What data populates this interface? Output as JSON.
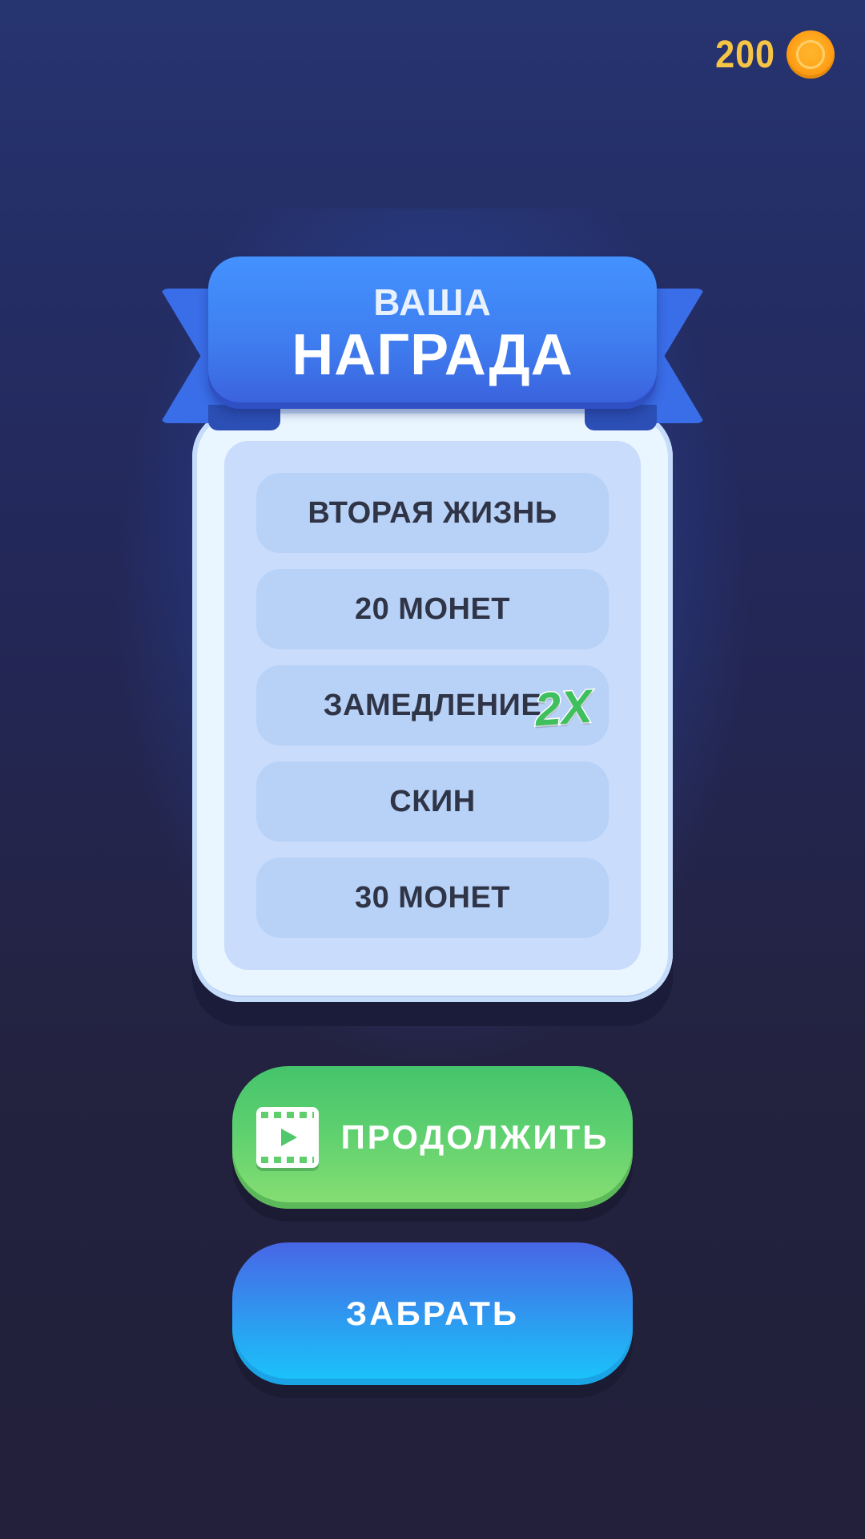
{
  "hud": {
    "coins": "200"
  },
  "reward": {
    "title_line1": "ВАША",
    "title_line2": "НАГРАДА",
    "items": [
      {
        "label": "ВТОРАЯ ЖИЗНЬ"
      },
      {
        "label": "20 МОНЕТ"
      },
      {
        "label": "ЗАМЕДЛЕНИЕ"
      },
      {
        "label": "СКИН"
      },
      {
        "label": "30 МОНЕТ"
      }
    ],
    "multiplier_badge": "2X"
  },
  "buttons": {
    "continue_label": "ПРОДОЛЖИТЬ",
    "claim_label": "ЗАБРАТЬ"
  },
  "icons": {
    "coin": "coin-icon",
    "video": "film-video-icon"
  },
  "colors": {
    "coin": "#f7c545",
    "continue": "#5dd06f",
    "claim": "#2d9bf0",
    "ribbon": "#3f7ef0"
  }
}
